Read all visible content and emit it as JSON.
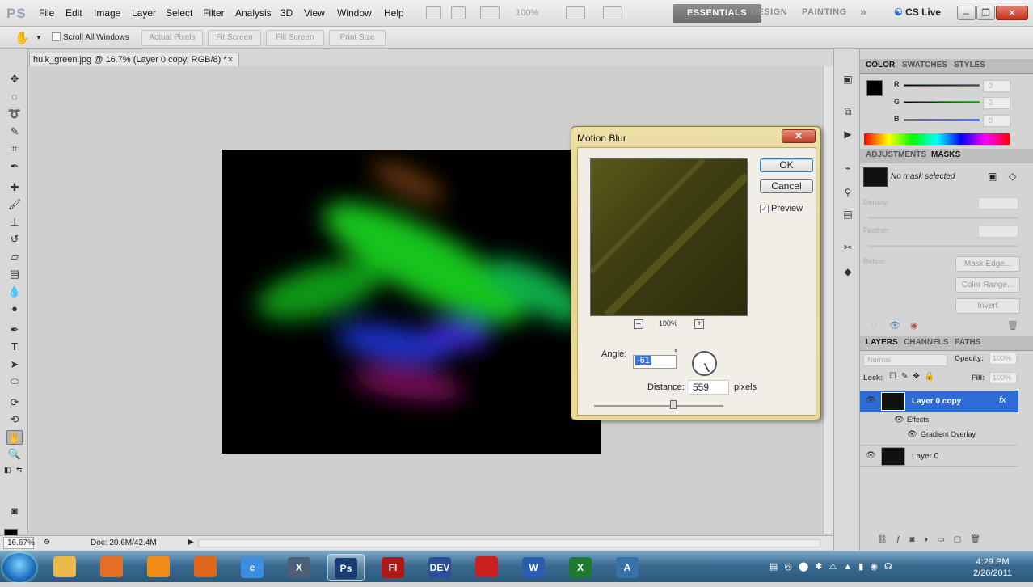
{
  "app": {
    "logo": "PS"
  },
  "menu": [
    "File",
    "Edit",
    "Image",
    "Layer",
    "Select",
    "Filter",
    "Analysis",
    "3D",
    "View",
    "Window",
    "Help"
  ],
  "topbar": {
    "zoom": "100%",
    "workspaces": [
      "ESSENTIALS",
      "DESIGN",
      "PAINTING"
    ],
    "more": "»",
    "cs_live": "CS Live"
  },
  "window_controls": {
    "minimize": "–",
    "restore": "❐",
    "close": "✕"
  },
  "options": {
    "scroll_all": "Scroll All Windows",
    "buttons": [
      "Actual Pixels",
      "Fit Screen",
      "Fill Screen",
      "Print Size"
    ]
  },
  "document": {
    "tab_title": "hulk_green.jpg @ 16.7% (Layer 0 copy, RGB/8) *",
    "tab_close": "✕"
  },
  "status": {
    "zoom": "16.67%",
    "doc": "Doc: 20.6M/42.4M"
  },
  "dialog": {
    "title": "Motion Blur",
    "close": "✕",
    "ok": "OK",
    "cancel": "Cancel",
    "preview_label": "Preview",
    "preview_checked": true,
    "zoom": "100%",
    "zoom_out": "–",
    "zoom_in": "+",
    "angle_label": "Angle:",
    "angle_value": "-61",
    "angle_unit": "°",
    "distance_label": "Distance:",
    "distance_value": "559",
    "distance_unit": "pixels",
    "distance_fraction": 0.61
  },
  "color_panel": {
    "tabs": [
      "COLOR",
      "SWATCHES",
      "STYLES"
    ],
    "channels": [
      {
        "label": "R",
        "value": "0",
        "color": "#d01010"
      },
      {
        "label": "G",
        "value": "0",
        "color": "#10b010"
      },
      {
        "label": "B",
        "value": "0",
        "color": "#1030d0"
      }
    ]
  },
  "masks_panel": {
    "tabs": [
      "ADJUSTMENTS",
      "MASKS"
    ],
    "no_mask": "No mask selected",
    "density": "Density:",
    "feather": "Feather:",
    "refine": "Refine:",
    "buttons": [
      "Mask Edge...",
      "Color Range...",
      "Invert"
    ]
  },
  "layers_panel": {
    "tabs": [
      "LAYERS",
      "CHANNELS",
      "PATHS"
    ],
    "blend_mode": "Normal",
    "opacity_label": "Opacity:",
    "opacity": "100%",
    "lock_label": "Lock:",
    "fill_label": "Fill:",
    "fill": "100%",
    "layers": [
      {
        "name": "Layer 0 copy",
        "fx": "fx",
        "selected": true
      },
      {
        "name": "Effects",
        "sub": true
      },
      {
        "name": "Gradient Overlay",
        "sub2": true
      },
      {
        "name": "Layer 0"
      }
    ]
  },
  "taskbar": {
    "apps": [
      {
        "name": "explorer",
        "label": ""
      },
      {
        "name": "media",
        "label": ""
      },
      {
        "name": "vlc",
        "label": ""
      },
      {
        "name": "firefox",
        "label": ""
      },
      {
        "name": "ie",
        "label": "e"
      },
      {
        "name": "x-app",
        "label": "X"
      },
      {
        "name": "photoshop",
        "label": "Ps",
        "active": true
      },
      {
        "name": "flash",
        "label": "Fl"
      },
      {
        "name": "dev",
        "label": "DEV"
      },
      {
        "name": "acrobat",
        "label": ""
      },
      {
        "name": "word",
        "label": "W"
      },
      {
        "name": "excel",
        "label": "X"
      },
      {
        "name": "arch",
        "label": "A"
      }
    ],
    "time": "4:29 PM",
    "date": "2/26/2011"
  }
}
